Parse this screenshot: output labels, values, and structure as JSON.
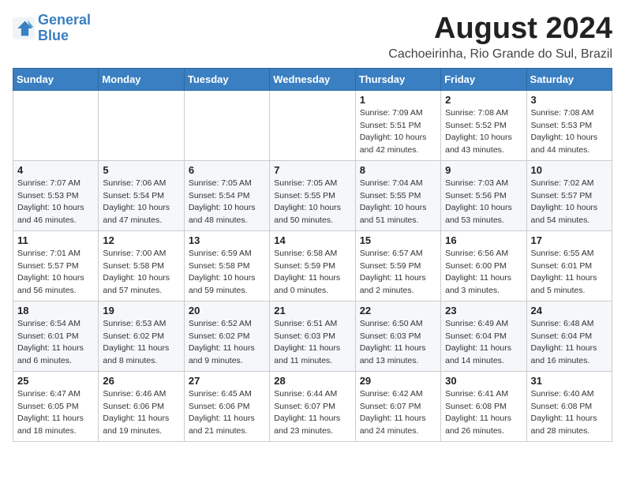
{
  "logo": {
    "line1": "General",
    "line2": "Blue"
  },
  "title": "August 2024",
  "location": "Cachoeirinha, Rio Grande do Sul, Brazil",
  "weekdays": [
    "Sunday",
    "Monday",
    "Tuesday",
    "Wednesday",
    "Thursday",
    "Friday",
    "Saturday"
  ],
  "weeks": [
    [
      {
        "day": "",
        "sunrise": "",
        "sunset": "",
        "daylight": ""
      },
      {
        "day": "",
        "sunrise": "",
        "sunset": "",
        "daylight": ""
      },
      {
        "day": "",
        "sunrise": "",
        "sunset": "",
        "daylight": ""
      },
      {
        "day": "",
        "sunrise": "",
        "sunset": "",
        "daylight": ""
      },
      {
        "day": "1",
        "sunrise": "7:09 AM",
        "sunset": "5:51 PM",
        "daylight": "10 hours and 42 minutes."
      },
      {
        "day": "2",
        "sunrise": "7:08 AM",
        "sunset": "5:52 PM",
        "daylight": "10 hours and 43 minutes."
      },
      {
        "day": "3",
        "sunrise": "7:08 AM",
        "sunset": "5:53 PM",
        "daylight": "10 hours and 44 minutes."
      }
    ],
    [
      {
        "day": "4",
        "sunrise": "7:07 AM",
        "sunset": "5:53 PM",
        "daylight": "10 hours and 46 minutes."
      },
      {
        "day": "5",
        "sunrise": "7:06 AM",
        "sunset": "5:54 PM",
        "daylight": "10 hours and 47 minutes."
      },
      {
        "day": "6",
        "sunrise": "7:05 AM",
        "sunset": "5:54 PM",
        "daylight": "10 hours and 48 minutes."
      },
      {
        "day": "7",
        "sunrise": "7:05 AM",
        "sunset": "5:55 PM",
        "daylight": "10 hours and 50 minutes."
      },
      {
        "day": "8",
        "sunrise": "7:04 AM",
        "sunset": "5:55 PM",
        "daylight": "10 hours and 51 minutes."
      },
      {
        "day": "9",
        "sunrise": "7:03 AM",
        "sunset": "5:56 PM",
        "daylight": "10 hours and 53 minutes."
      },
      {
        "day": "10",
        "sunrise": "7:02 AM",
        "sunset": "5:57 PM",
        "daylight": "10 hours and 54 minutes."
      }
    ],
    [
      {
        "day": "11",
        "sunrise": "7:01 AM",
        "sunset": "5:57 PM",
        "daylight": "10 hours and 56 minutes."
      },
      {
        "day": "12",
        "sunrise": "7:00 AM",
        "sunset": "5:58 PM",
        "daylight": "10 hours and 57 minutes."
      },
      {
        "day": "13",
        "sunrise": "6:59 AM",
        "sunset": "5:58 PM",
        "daylight": "10 hours and 59 minutes."
      },
      {
        "day": "14",
        "sunrise": "6:58 AM",
        "sunset": "5:59 PM",
        "daylight": "11 hours and 0 minutes."
      },
      {
        "day": "15",
        "sunrise": "6:57 AM",
        "sunset": "5:59 PM",
        "daylight": "11 hours and 2 minutes."
      },
      {
        "day": "16",
        "sunrise": "6:56 AM",
        "sunset": "6:00 PM",
        "daylight": "11 hours and 3 minutes."
      },
      {
        "day": "17",
        "sunrise": "6:55 AM",
        "sunset": "6:01 PM",
        "daylight": "11 hours and 5 minutes."
      }
    ],
    [
      {
        "day": "18",
        "sunrise": "6:54 AM",
        "sunset": "6:01 PM",
        "daylight": "11 hours and 6 minutes."
      },
      {
        "day": "19",
        "sunrise": "6:53 AM",
        "sunset": "6:02 PM",
        "daylight": "11 hours and 8 minutes."
      },
      {
        "day": "20",
        "sunrise": "6:52 AM",
        "sunset": "6:02 PM",
        "daylight": "11 hours and 9 minutes."
      },
      {
        "day": "21",
        "sunrise": "6:51 AM",
        "sunset": "6:03 PM",
        "daylight": "11 hours and 11 minutes."
      },
      {
        "day": "22",
        "sunrise": "6:50 AM",
        "sunset": "6:03 PM",
        "daylight": "11 hours and 13 minutes."
      },
      {
        "day": "23",
        "sunrise": "6:49 AM",
        "sunset": "6:04 PM",
        "daylight": "11 hours and 14 minutes."
      },
      {
        "day": "24",
        "sunrise": "6:48 AM",
        "sunset": "6:04 PM",
        "daylight": "11 hours and 16 minutes."
      }
    ],
    [
      {
        "day": "25",
        "sunrise": "6:47 AM",
        "sunset": "6:05 PM",
        "daylight": "11 hours and 18 minutes."
      },
      {
        "day": "26",
        "sunrise": "6:46 AM",
        "sunset": "6:06 PM",
        "daylight": "11 hours and 19 minutes."
      },
      {
        "day": "27",
        "sunrise": "6:45 AM",
        "sunset": "6:06 PM",
        "daylight": "11 hours and 21 minutes."
      },
      {
        "day": "28",
        "sunrise": "6:44 AM",
        "sunset": "6:07 PM",
        "daylight": "11 hours and 23 minutes."
      },
      {
        "day": "29",
        "sunrise": "6:42 AM",
        "sunset": "6:07 PM",
        "daylight": "11 hours and 24 minutes."
      },
      {
        "day": "30",
        "sunrise": "6:41 AM",
        "sunset": "6:08 PM",
        "daylight": "11 hours and 26 minutes."
      },
      {
        "day": "31",
        "sunrise": "6:40 AM",
        "sunset": "6:08 PM",
        "daylight": "11 hours and 28 minutes."
      }
    ]
  ]
}
